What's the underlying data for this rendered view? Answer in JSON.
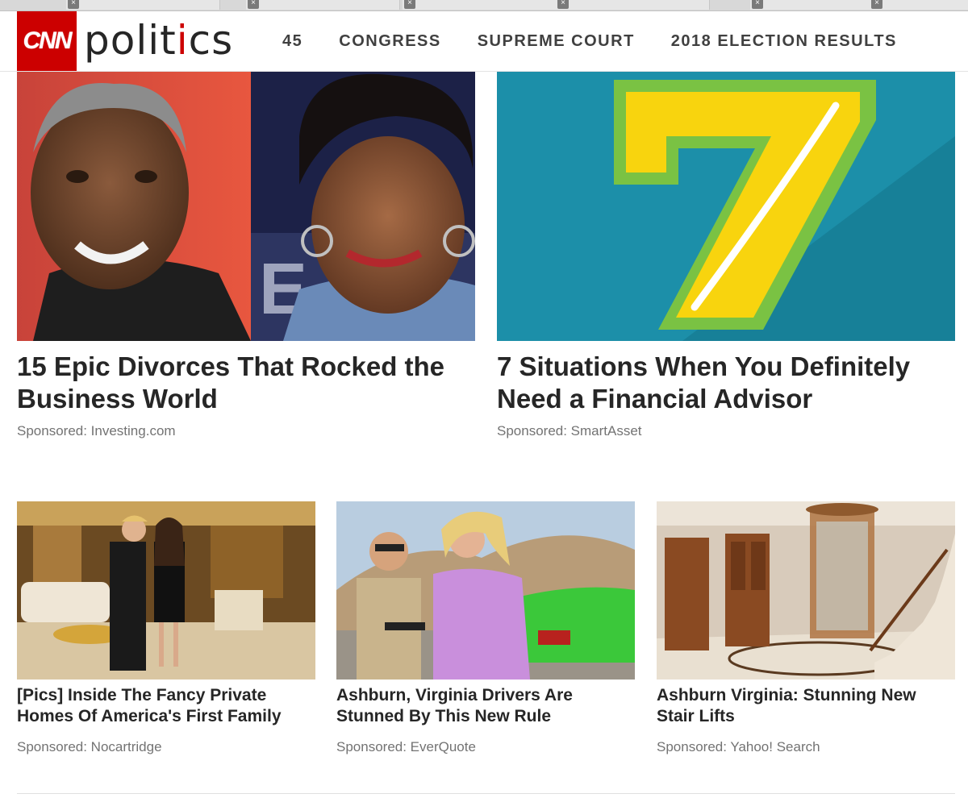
{
  "header": {
    "logo_text": "CNN",
    "section": "politics",
    "nav": [
      "45",
      "CONGRESS",
      "SUPREME COURT",
      "2018 ELECTION RESULTS"
    ]
  },
  "colors": {
    "brand_red": "#cc0000",
    "title_text": "#262626",
    "sponsor_text": "#737373"
  },
  "cards_large": [
    {
      "title": "15 Epic Divorces That Rocked the Business World",
      "sponsor": "Sponsored: Investing.com",
      "image": "two-people-photo"
    },
    {
      "title": "7 Situations When You Definitely Need a Financial Advisor",
      "sponsor": "Sponsored: SmartAsset",
      "image": "number-seven-graphic"
    }
  ],
  "cards_small": [
    {
      "title": "[Pics] Inside The Fancy Private Homes Of America's First Family",
      "sponsor": "Sponsored: Nocartridge",
      "image": "gilded-room-photo"
    },
    {
      "title": "Ashburn, Virginia Drivers Are Stunned By This New Rule",
      "sponsor": "Sponsored: EverQuote",
      "image": "traffic-stop-photo"
    },
    {
      "title": "Ashburn Virginia: Stunning New Stair Lifts",
      "sponsor": "Sponsored: Yahoo! Search",
      "image": "staircase-interior-photo"
    }
  ]
}
